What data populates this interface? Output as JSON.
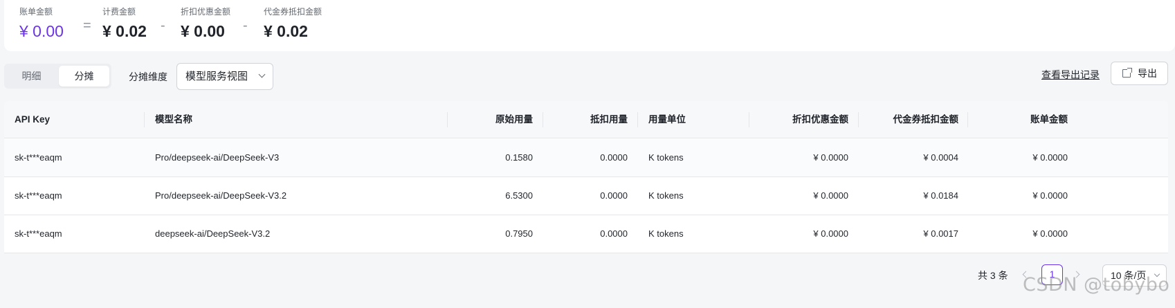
{
  "summary": {
    "bill_label": "账单金额",
    "bill_value": "¥ 0.00",
    "eq": "=",
    "charge_label": "计费金额",
    "charge_value": "¥ 0.02",
    "minus1": "-",
    "discount_label": "折扣优惠金额",
    "discount_value": "¥ 0.00",
    "minus2": "-",
    "voucher_label": "代金券抵扣金额",
    "voucher_value": "¥ 0.02"
  },
  "toolbar": {
    "tab_detail": "明细",
    "tab_allocation": "分摊",
    "dimension_label": "分摊维度",
    "dimension_value": "模型服务视图",
    "export_records": "查看导出记录",
    "export": "导出"
  },
  "table": {
    "headers": {
      "api_key": "API Key",
      "model": "模型名称",
      "raw_usage": "原始用量",
      "deducted_usage": "抵扣用量",
      "unit": "用量单位",
      "discount": "折扣优惠金额",
      "voucher": "代金券抵扣金额",
      "bill": "账单金额"
    },
    "rows": [
      {
        "api_key": "sk-t***eaqm",
        "model": "Pro/deepseek-ai/DeepSeek-V3",
        "raw_usage": "0.1580",
        "deducted_usage": "0.0000",
        "unit": "K tokens",
        "discount": "¥ 0.0000",
        "voucher": "¥ 0.0004",
        "bill": "¥ 0.0000"
      },
      {
        "api_key": "sk-t***eaqm",
        "model": "Pro/deepseek-ai/DeepSeek-V3.2",
        "raw_usage": "6.5300",
        "deducted_usage": "0.0000",
        "unit": "K tokens",
        "discount": "¥ 0.0000",
        "voucher": "¥ 0.0184",
        "bill": "¥ 0.0000"
      },
      {
        "api_key": "sk-t***eaqm",
        "model": "deepseek-ai/DeepSeek-V3.2",
        "raw_usage": "0.7950",
        "deducted_usage": "0.0000",
        "unit": "K tokens",
        "discount": "¥ 0.0000",
        "voucher": "¥ 0.0017",
        "bill": "¥ 0.0000"
      }
    ]
  },
  "pagination": {
    "total": "共 3 条",
    "current_page": "1",
    "page_size": "10 条/页"
  },
  "watermark": "CSDN @tobybo",
  "colors": {
    "accent": "#6b34ea",
    "border": "#e4e6ea",
    "header_bg": "#f7f8fa"
  }
}
